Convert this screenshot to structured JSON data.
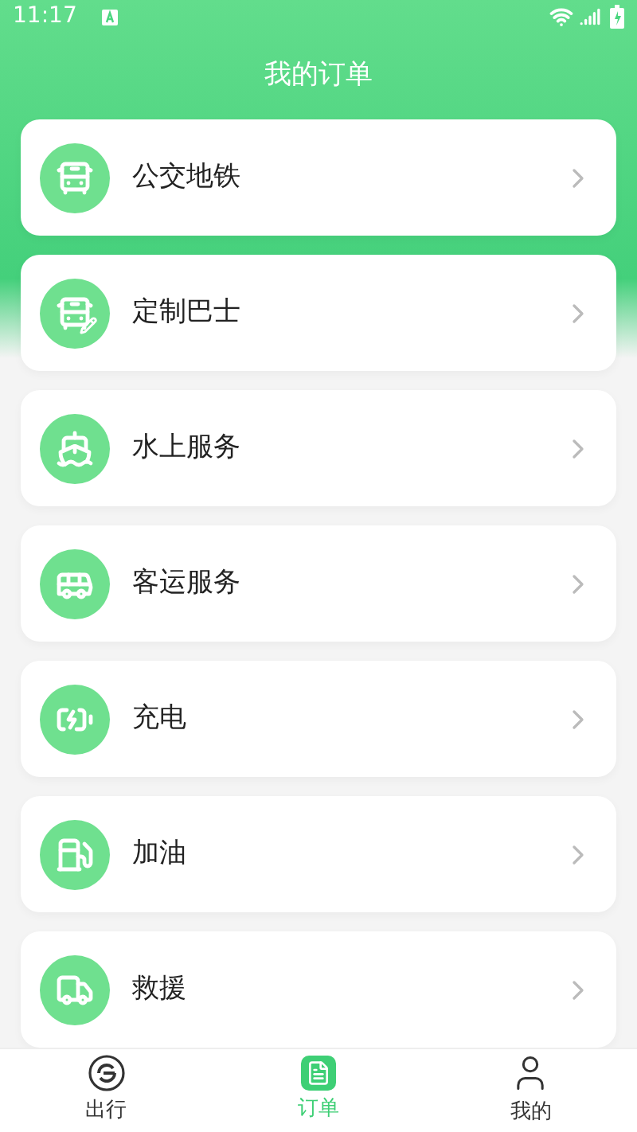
{
  "status_bar": {
    "time": "11:17"
  },
  "title": "我的订单",
  "orders": [
    {
      "kind": "bus",
      "label": "公交地铁"
    },
    {
      "kind": "custom-bus",
      "label": "定制巴士"
    },
    {
      "kind": "ship",
      "label": "水上服务"
    },
    {
      "kind": "coach",
      "label": "客运服务"
    },
    {
      "kind": "charge",
      "label": "充电"
    },
    {
      "kind": "fuel",
      "label": "加油"
    },
    {
      "kind": "rescue",
      "label": "救援"
    }
  ],
  "nav": [
    {
      "kind": "travel",
      "label": "出行",
      "selected": false
    },
    {
      "kind": "orders",
      "label": "订单",
      "selected": true
    },
    {
      "kind": "me",
      "label": "我的",
      "selected": false
    }
  ]
}
